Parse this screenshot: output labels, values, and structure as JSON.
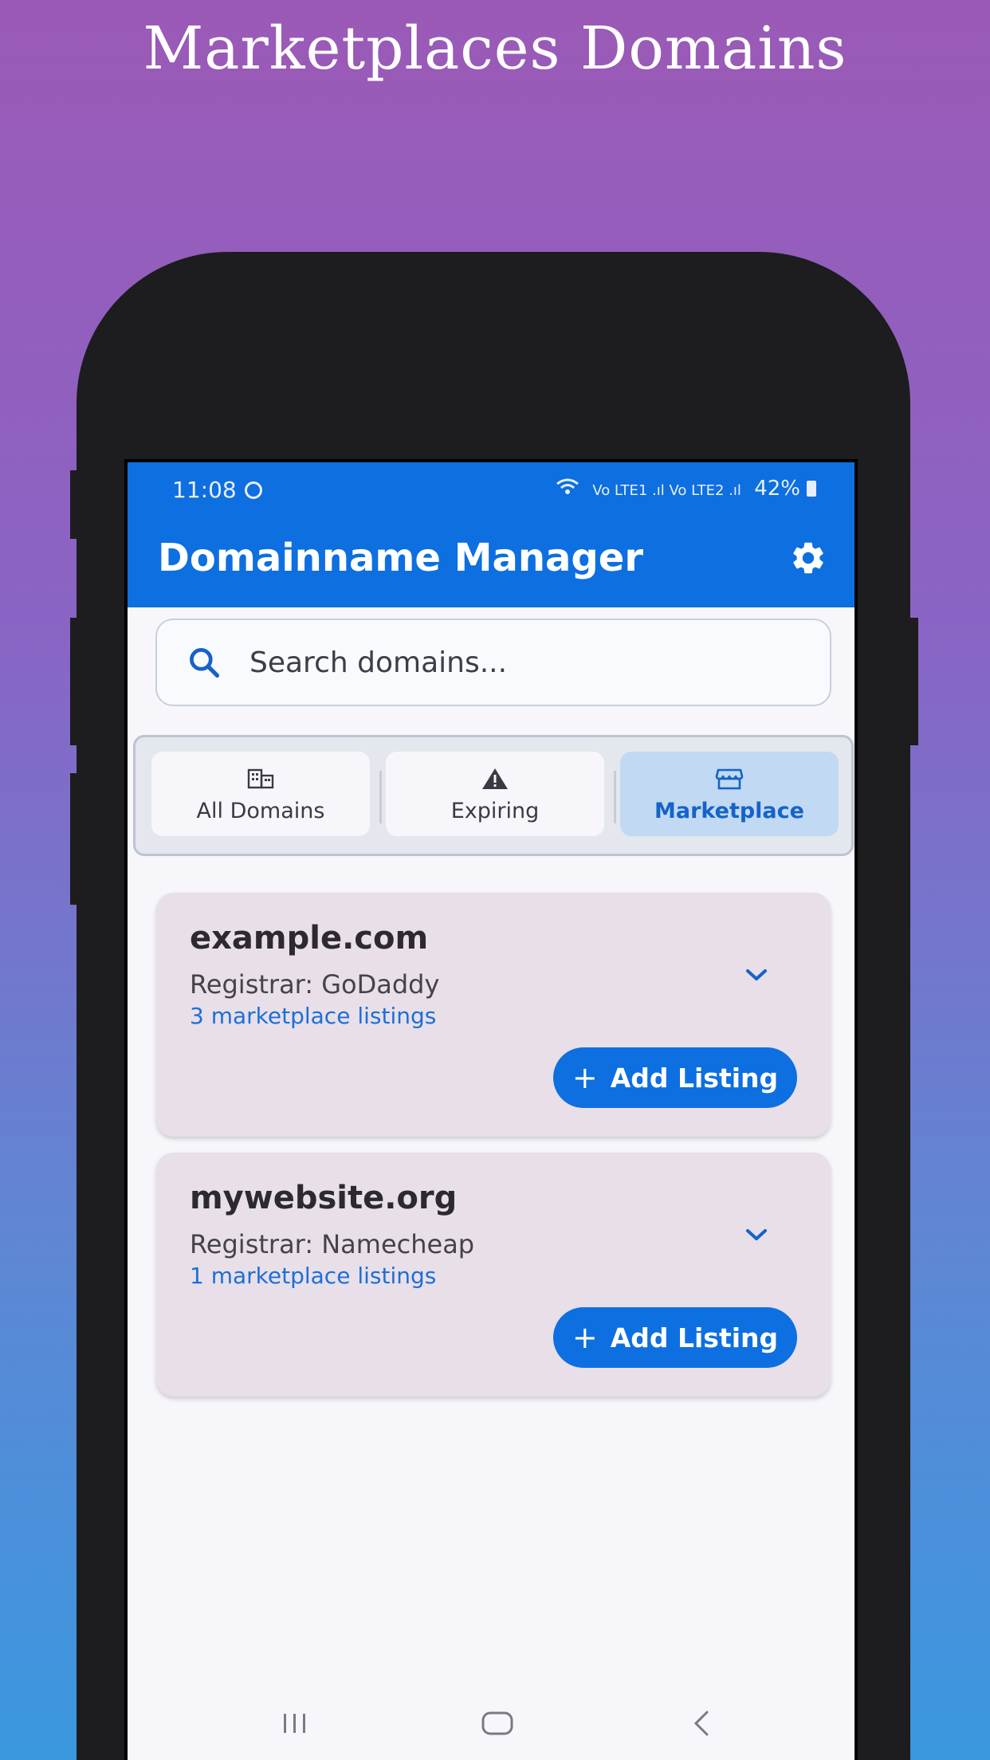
{
  "promo": {
    "title": "Marketplaces Domains"
  },
  "status_bar": {
    "time": "11:08",
    "signal_text": "Vo LTE1 .ıl Vo LTE2 .ıl",
    "battery": "42%"
  },
  "app_bar": {
    "title": "Domainname Manager",
    "settings_icon": "gear-icon"
  },
  "search": {
    "placeholder": "Search domains...",
    "value": ""
  },
  "tabs": [
    {
      "label": "All Domains",
      "icon": "building-icon",
      "active": false
    },
    {
      "label": "Expiring",
      "icon": "warning-icon",
      "active": false
    },
    {
      "label": "Marketplace",
      "icon": "storefront-icon",
      "active": true
    }
  ],
  "domains": [
    {
      "name": "example.com",
      "registrar": "Registrar: GoDaddy",
      "listings": "3 marketplace listings",
      "add_label": "Add Listing"
    },
    {
      "name": "mywebsite.org",
      "registrar": "Registrar: Namecheap",
      "listings": "1 marketplace listings",
      "add_label": "Add Listing"
    }
  ],
  "colors": {
    "accent": "#0d6fe0",
    "card_bg": "#e8dfe9",
    "active_tab_bg": "#c1d9f3",
    "link": "#1d6fd6"
  }
}
